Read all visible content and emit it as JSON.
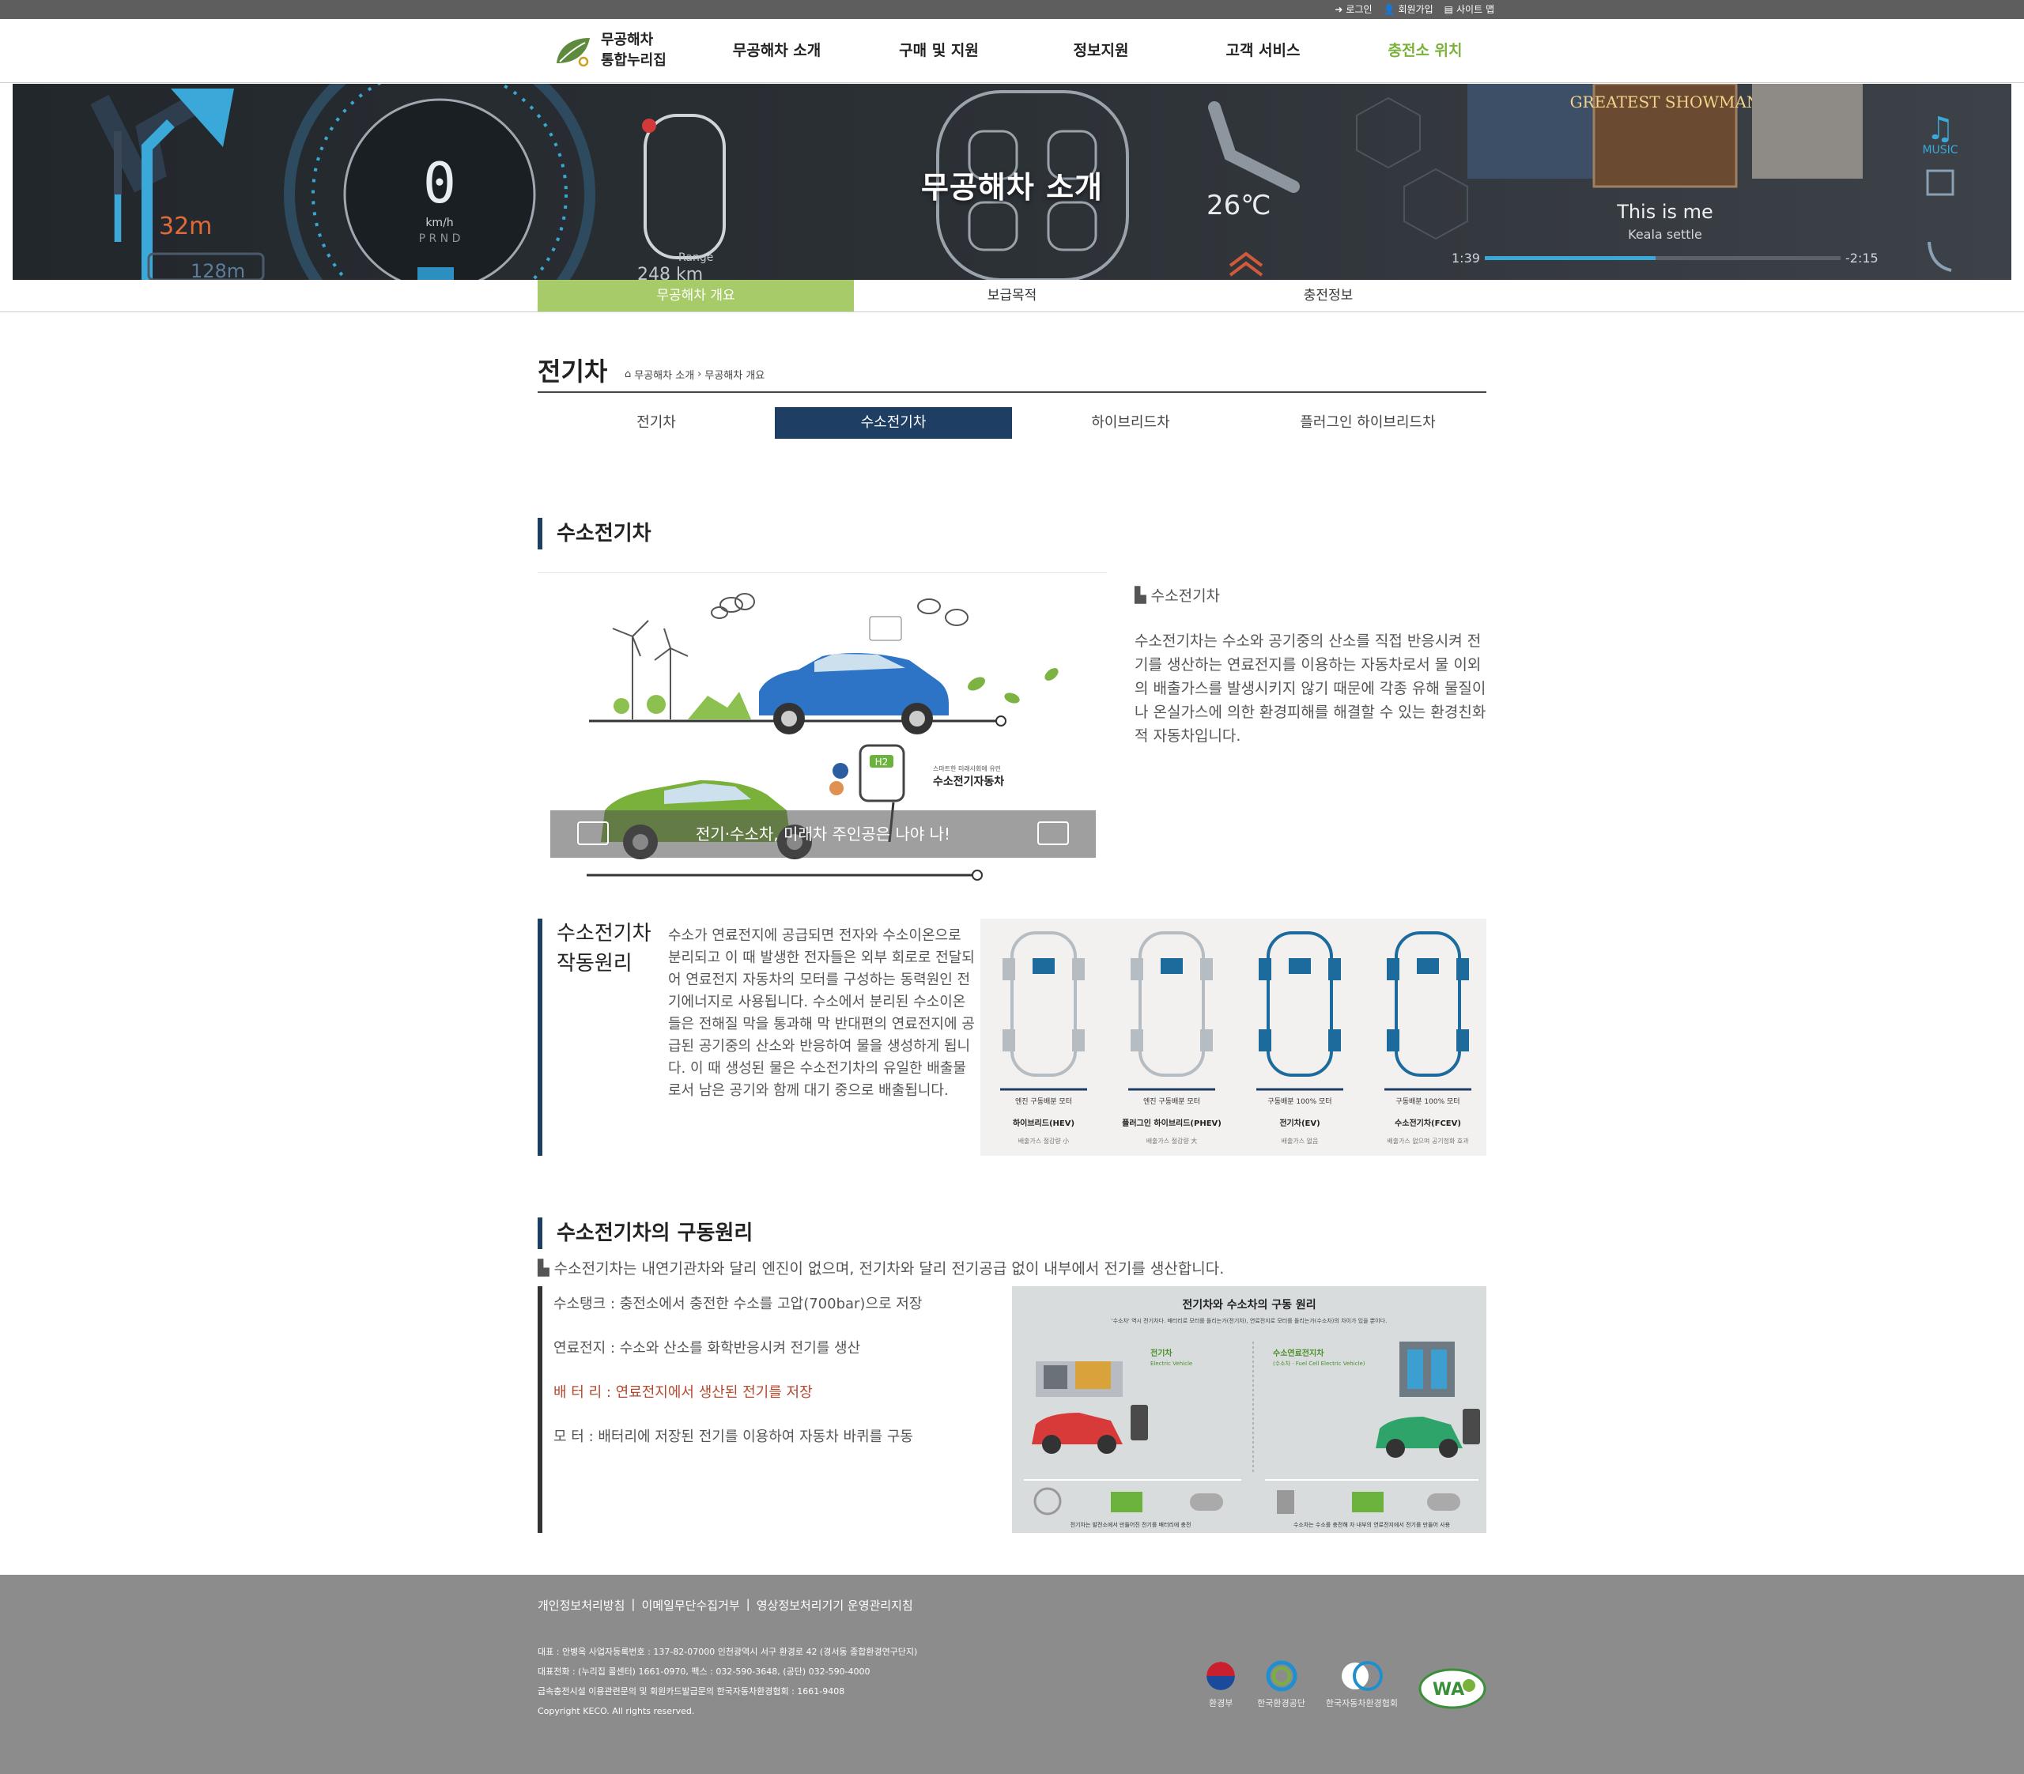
{
  "util": {
    "login": "로그인",
    "join": "회원가입",
    "sitemap": "사이트 맵"
  },
  "logo": {
    "line1": "무공해차",
    "line2": "통합누리집"
  },
  "gnb": [
    "무공해차 소개",
    "구매 및 지원",
    "정보지원",
    "고객 서비스",
    "충전소 위치"
  ],
  "banner": {
    "title": "무공해차 소개",
    "speed": "0",
    "speed_unit": "km/h",
    "gear": "P R N D",
    "distance1": "32m",
    "distance2": "128m",
    "range_label": "Range",
    "range_value": "248 km",
    "temp": "26℃",
    "music_label": "MUSIC",
    "album": "GREATEST SHOWMAN",
    "track": "This is me",
    "artist": "Keala settle",
    "time_left": "1:39",
    "time_right": "-2:15",
    "progress": 0.48
  },
  "subnav": [
    "무공해차 개요",
    "보급목적",
    "충전정보"
  ],
  "page": {
    "title": "전기차",
    "breadcrumb": [
      "무공해차 소개",
      "무공해차 개요"
    ]
  },
  "vtabs": [
    "전기차",
    "수소전기차",
    "하이브리드차",
    "플러그인 하이브리드차"
  ],
  "intro": {
    "section_title": "수소전기차",
    "subtitle": "수소전기차",
    "body": "수소전기차는 수소와 공기중의 산소를 직접 반응시켜 전기를 생산하는 연료전지를 이용하는 자동차로서 물 이외의 배출가스를 발생시키지 않기 때문에 각종 유해 물질이나 온실가스에 의한 환경피해를 해결할 수 있는 환경친화적 자동차입니다.",
    "image_caption": "전기·수소차, 미래차 주인공은 나야 나!",
    "image_small_label": "수소전기자동차",
    "image_small_sub": "스마트한 미래사회에 유린",
    "h2_label": "H2"
  },
  "principle": {
    "title_line1": "수소전기차",
    "title_line2": "작동원리",
    "body": "수소가 연료전지에 공급되면 전자와 수소이온으로 분리되고 이 때 발생한 전자들은 외부 회로로 전달되어 연료전지 자동차의 모터를 구성하는 동력원인 전기에너지로 사용됩니다. 수소에서 분리된 수소이온들은 전해질 막을 통과해 막 반대편의 연료전지에 공급된 공기중의 산소와 반응하여 물을 생성하게 됩니다. 이 때 생성된 물은 수소전기차의 유일한 배출물로서 남은 공기와 함께 대기 중으로 배출됩니다.",
    "diagrams": [
      {
        "scale": "엔진 구동배분 모터",
        "name": "하이브리드(HEV)",
        "note": "배출가스 절감량 小"
      },
      {
        "scale": "엔진 구동배분 모터",
        "name": "플러그인 하이브리드(PHEV)",
        "note": "배출가스 절감량 大"
      },
      {
        "scale": "구동배분 100% 모터",
        "name": "전기차(EV)",
        "note": "배출가스 없음"
      },
      {
        "scale": "구동배분 100% 모터",
        "name": "수소전기차(FCEV)",
        "note": "배출가스 없으며 공기정화 효과"
      }
    ]
  },
  "drive": {
    "section_title": "수소전기차의 구동원리",
    "note": "수소전기차는 내연기관차와 달리 엔진이 없으며, 전기차와 달리 전기공급 없이 내부에서 전기를 생산합니다.",
    "items": [
      "수소탱크 : 충전소에서 충전한 수소를 고압(700bar)으로 저장",
      "연료전지 : 수소와 산소를 화학반응시켜 전기를 생산",
      "배 터 리 : 연료전지에서 생산된 전기를 저장",
      "모 터 : 배터리에 저장된 전기를 이용하여 자동차 바퀴를 구동"
    ],
    "image_title": "전기차와 수소차의 구동 원리",
    "image_sub": "'수소차' 역시 전기차다. 배터리로 모터를 돌리는가(전기차), 연료전지로 모터를 돌리는가(수소차)의 차이가 있을 뿐이다.",
    "ev_label": "전기차",
    "ev_label_en": "Electric Vehicle",
    "fcev_label": "수소연료전지차",
    "fcev_label_en": "(수소차 · Fuel Cell Electric Vehicle)",
    "ev_caption": "전기차는 발전소에서 만들어진 전기를 배터리에 충전",
    "fcev_caption": "수소차는 수소를 충전해 차 내부의 연료전지에서 전기를 만들어 사용"
  },
  "footer": {
    "links": [
      "개인정보처리방침",
      "이메일무단수집거부",
      "영상정보처리기기 운영관리지침"
    ],
    "info": [
      "대표 : 안병옥 사업자등록번호 : 137-82-07000 인천광역시 서구 환경로 42 (경서동 종합환경연구단지)",
      "대표전화 : (누리집 콜센터) 1661-0970, 팩스 : 032-590-3648, (공단) 032-590-4000",
      "급속충전시설 이용관련문의 및 회원카드발급문의 한국자동차환경협회 : 1661-9408",
      "Copyright KECO. All rights reserved."
    ],
    "logos": [
      "환경부",
      "한국환경공단",
      "한국자동차환경협회",
      "WA"
    ]
  },
  "colors": {
    "accent_green": "#a8cb6a",
    "nav_active": "#7ab13a",
    "navy": "#1f3e63",
    "footer_bg": "#8c8c8c"
  }
}
